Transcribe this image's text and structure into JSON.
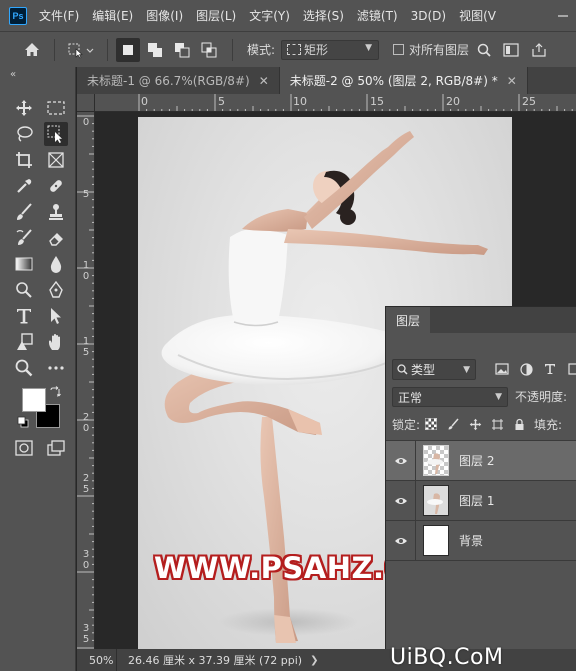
{
  "app": {
    "logo": "Ps"
  },
  "menu": [
    "文件(F)",
    "编辑(E)",
    "图像(I)",
    "图层(L)",
    "文字(Y)",
    "选择(S)",
    "滤镜(T)",
    "3D(D)",
    "视图(V"
  ],
  "options": {
    "mode_label": "模式:",
    "mode_value": "矩形",
    "sample_all_label": "对所有图层"
  },
  "tabs": [
    {
      "label": "未标题-1 @ 66.7%(RGB/8#)",
      "active": false
    },
    {
      "label": "未标题-2 @ 50% (图层 2, RGB/8#) *",
      "active": true
    }
  ],
  "ruler": {
    "top": [
      "0",
      "5",
      "10",
      "15",
      "20",
      "25"
    ],
    "left": [
      "0",
      "5",
      "1\n0",
      "1\n5",
      "2\n0",
      "2\n5",
      "3\n0",
      "3\n5"
    ]
  },
  "canvas": {
    "watermark": "WWW.PSAHZ.COM"
  },
  "layers_panel": {
    "tab": "图层",
    "filter_value": "类型",
    "blend_mode": "正常",
    "opacity_label": "不透明度:",
    "lock_label": "锁定:",
    "fill_label": "填充:",
    "layers": [
      {
        "name": "图层 2",
        "selected": true,
        "thumb": "checker"
      },
      {
        "name": "图层 1",
        "selected": false,
        "thumb": "photo"
      },
      {
        "name": "背景",
        "selected": false,
        "thumb": "white"
      }
    ]
  },
  "status": {
    "zoom": "50%",
    "doc_info": "26.46 厘米 x 37.39 厘米 (72 ppi)"
  },
  "site_mark": "UiBQ.CoM",
  "colors": {
    "accent": "#31a8ff",
    "watermark_outline": "#b41e1e",
    "foreground": "#ffffff",
    "background": "#000000"
  }
}
